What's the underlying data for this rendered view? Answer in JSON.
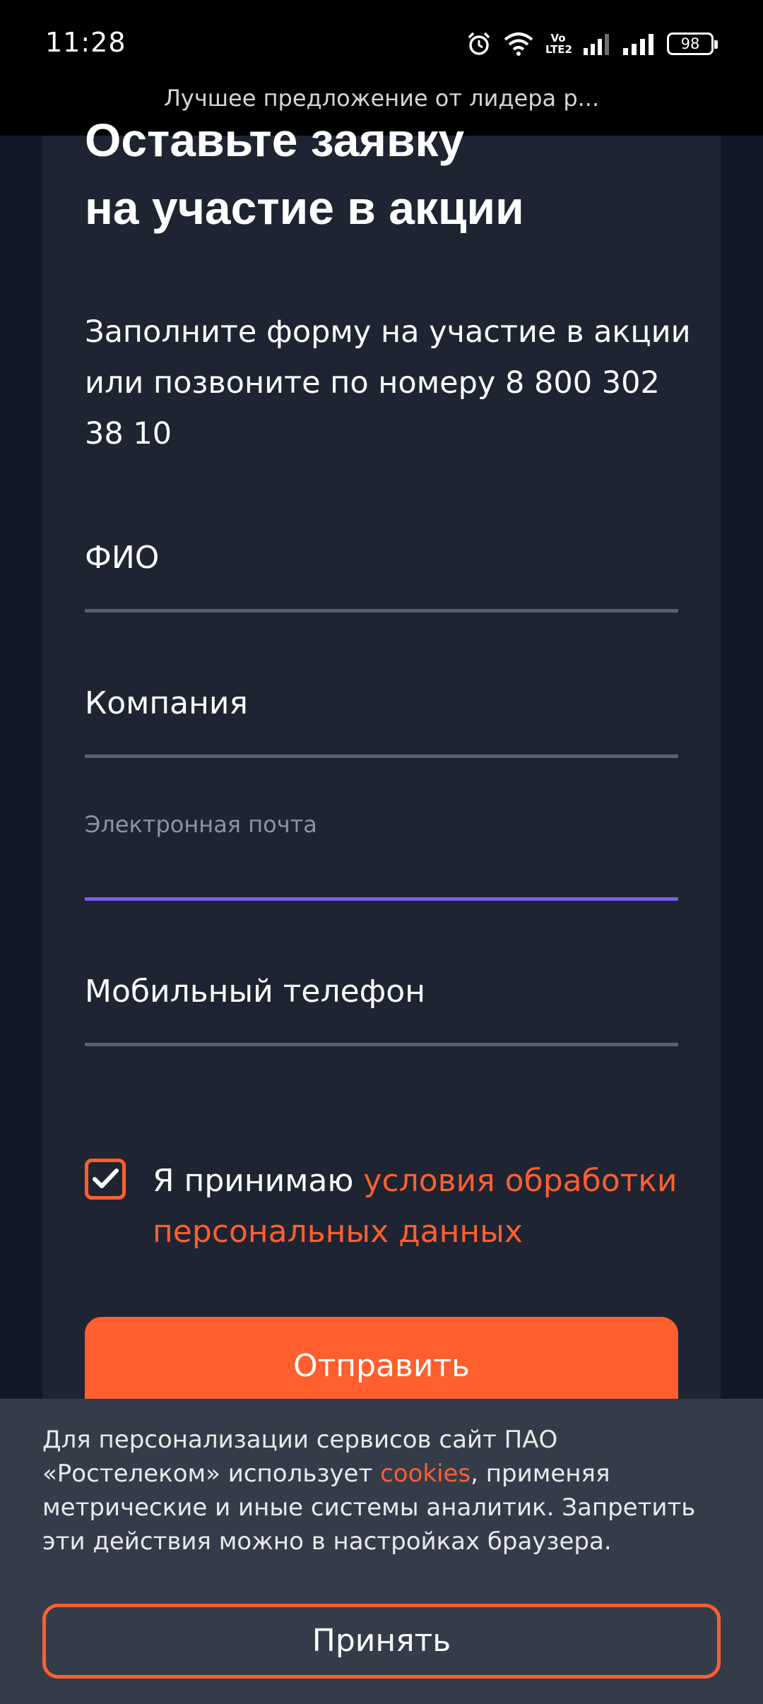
{
  "status_bar": {
    "time": "11:28",
    "volte_label": "Vo LTE2",
    "battery": "98",
    "icons": [
      "alarm-icon",
      "wifi-icon",
      "volte-icon",
      "signal-icon",
      "signal-icon",
      "battery-icon"
    ]
  },
  "browser": {
    "page_title": "Лучшее предложение от лидера р..."
  },
  "form": {
    "heading_line1": "Оставьте заявку",
    "heading_line2": "на участие в акции",
    "intro": "Заполните форму на участие в акции или позвоните по номеру 8 800 302 38 10",
    "fields": [
      {
        "label": "ФИО"
      },
      {
        "label": "Компания"
      },
      {
        "label": "Электронная почта"
      },
      {
        "label": "Мобильный телефон"
      }
    ],
    "consent_prefix": "Я принимаю ",
    "consent_link": "условия обработки персональных данных",
    "consent_checked": true,
    "submit_label": "Отправить"
  },
  "cookie_banner": {
    "text_before": "Для персонализации сервисов сайт ПАО «Ростелеком» использует ",
    "link": "cookies",
    "text_after": ", применяя метрические и иные системы аналитик. Запретить эти действия можно в настройках браузера.",
    "accept_label": "Принять"
  },
  "colors": {
    "accent": "#ff5f2e",
    "focus_line": "#7b5cf0",
    "card_bg": "#1f2433",
    "page_bg": "#121826",
    "banner_bg": "#353c49"
  }
}
